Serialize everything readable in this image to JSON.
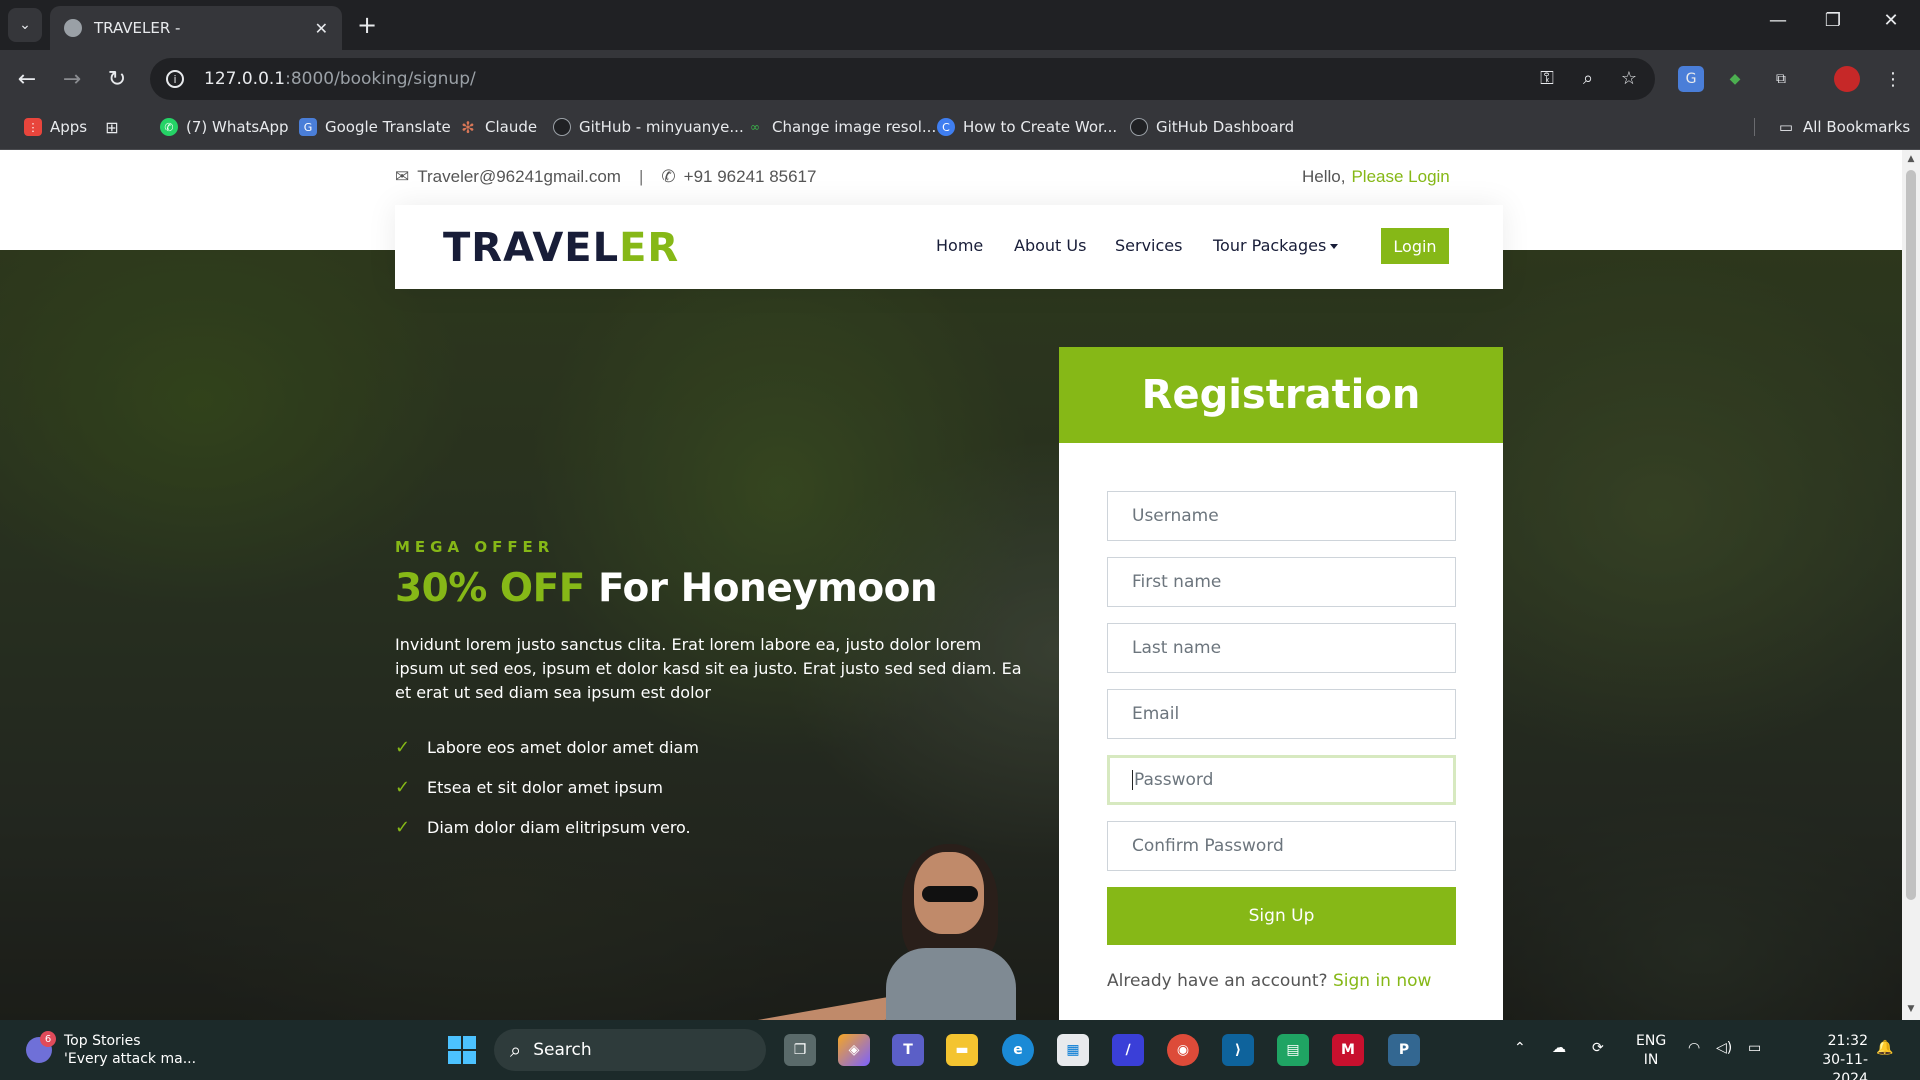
{
  "browser": {
    "tab_title": "TRAVELER -",
    "url_host": "127.0.0.1",
    "url_path": ":8000/booking/signup/",
    "bookmarks": [
      {
        "label": "Apps",
        "icon": "apps-grid-icon"
      },
      {
        "label": "(7) WhatsApp",
        "icon": "whatsapp-icon"
      },
      {
        "label": "Google Translate",
        "icon": "google-translate-icon"
      },
      {
        "label": "Claude",
        "icon": "claude-icon"
      },
      {
        "label": "GitHub - minyuanye...",
        "icon": "github-icon"
      },
      {
        "label": "Change image resol...",
        "icon": "change-image-icon"
      },
      {
        "label": "How to Create Wor...",
        "icon": "wordpress-icon"
      },
      {
        "label": "GitHub Dashboard",
        "icon": "github-icon"
      }
    ],
    "all_bookmarks": "All Bookmarks"
  },
  "site": {
    "email": "Traveler@96241gmail.com",
    "phone": "+91 96241 85617",
    "hello": "Hello,",
    "please_login": "Please Login",
    "brand_dark": "TRAVEL",
    "brand_accent": "ER",
    "nav": {
      "home": "Home",
      "about": "About Us",
      "services": "Services",
      "tours": "Tour Packages",
      "login": "Login"
    },
    "offer": {
      "kicker": "MEGA OFFER",
      "percent": "30% OFF",
      "headline": "For Honeymoon",
      "body": "Invidunt lorem justo sanctus clita. Erat lorem labore ea, justo dolor lorem ipsum ut sed eos, ipsum et dolor kasd sit ea justo. Erat justo sed sed diam. Ea et erat ut sed diam sea ipsum est dolor",
      "bullets": [
        "Labore eos amet dolor amet diam",
        "Etsea et sit dolor amet ipsum",
        "Diam dolor diam elitripsum vero."
      ]
    },
    "registration": {
      "title": "Registration",
      "username_placeholder": "Username",
      "firstname_placeholder": "First name",
      "lastname_placeholder": "Last name",
      "email_placeholder": "Email",
      "password_placeholder": "Password",
      "confirm_placeholder": "Confirm Password",
      "submit": "Sign Up",
      "already": "Already have an account?",
      "signin": "Sign in now"
    }
  },
  "taskbar": {
    "news_title": "Top Stories",
    "news_sub": "'Every attack ma...",
    "news_badge": "6",
    "search": "Search",
    "lang_1": "ENG",
    "lang_2": "IN",
    "time": "21:32",
    "date": "30-11-2024"
  },
  "colors": {
    "accent": "#86b817",
    "navy": "#181d38"
  }
}
